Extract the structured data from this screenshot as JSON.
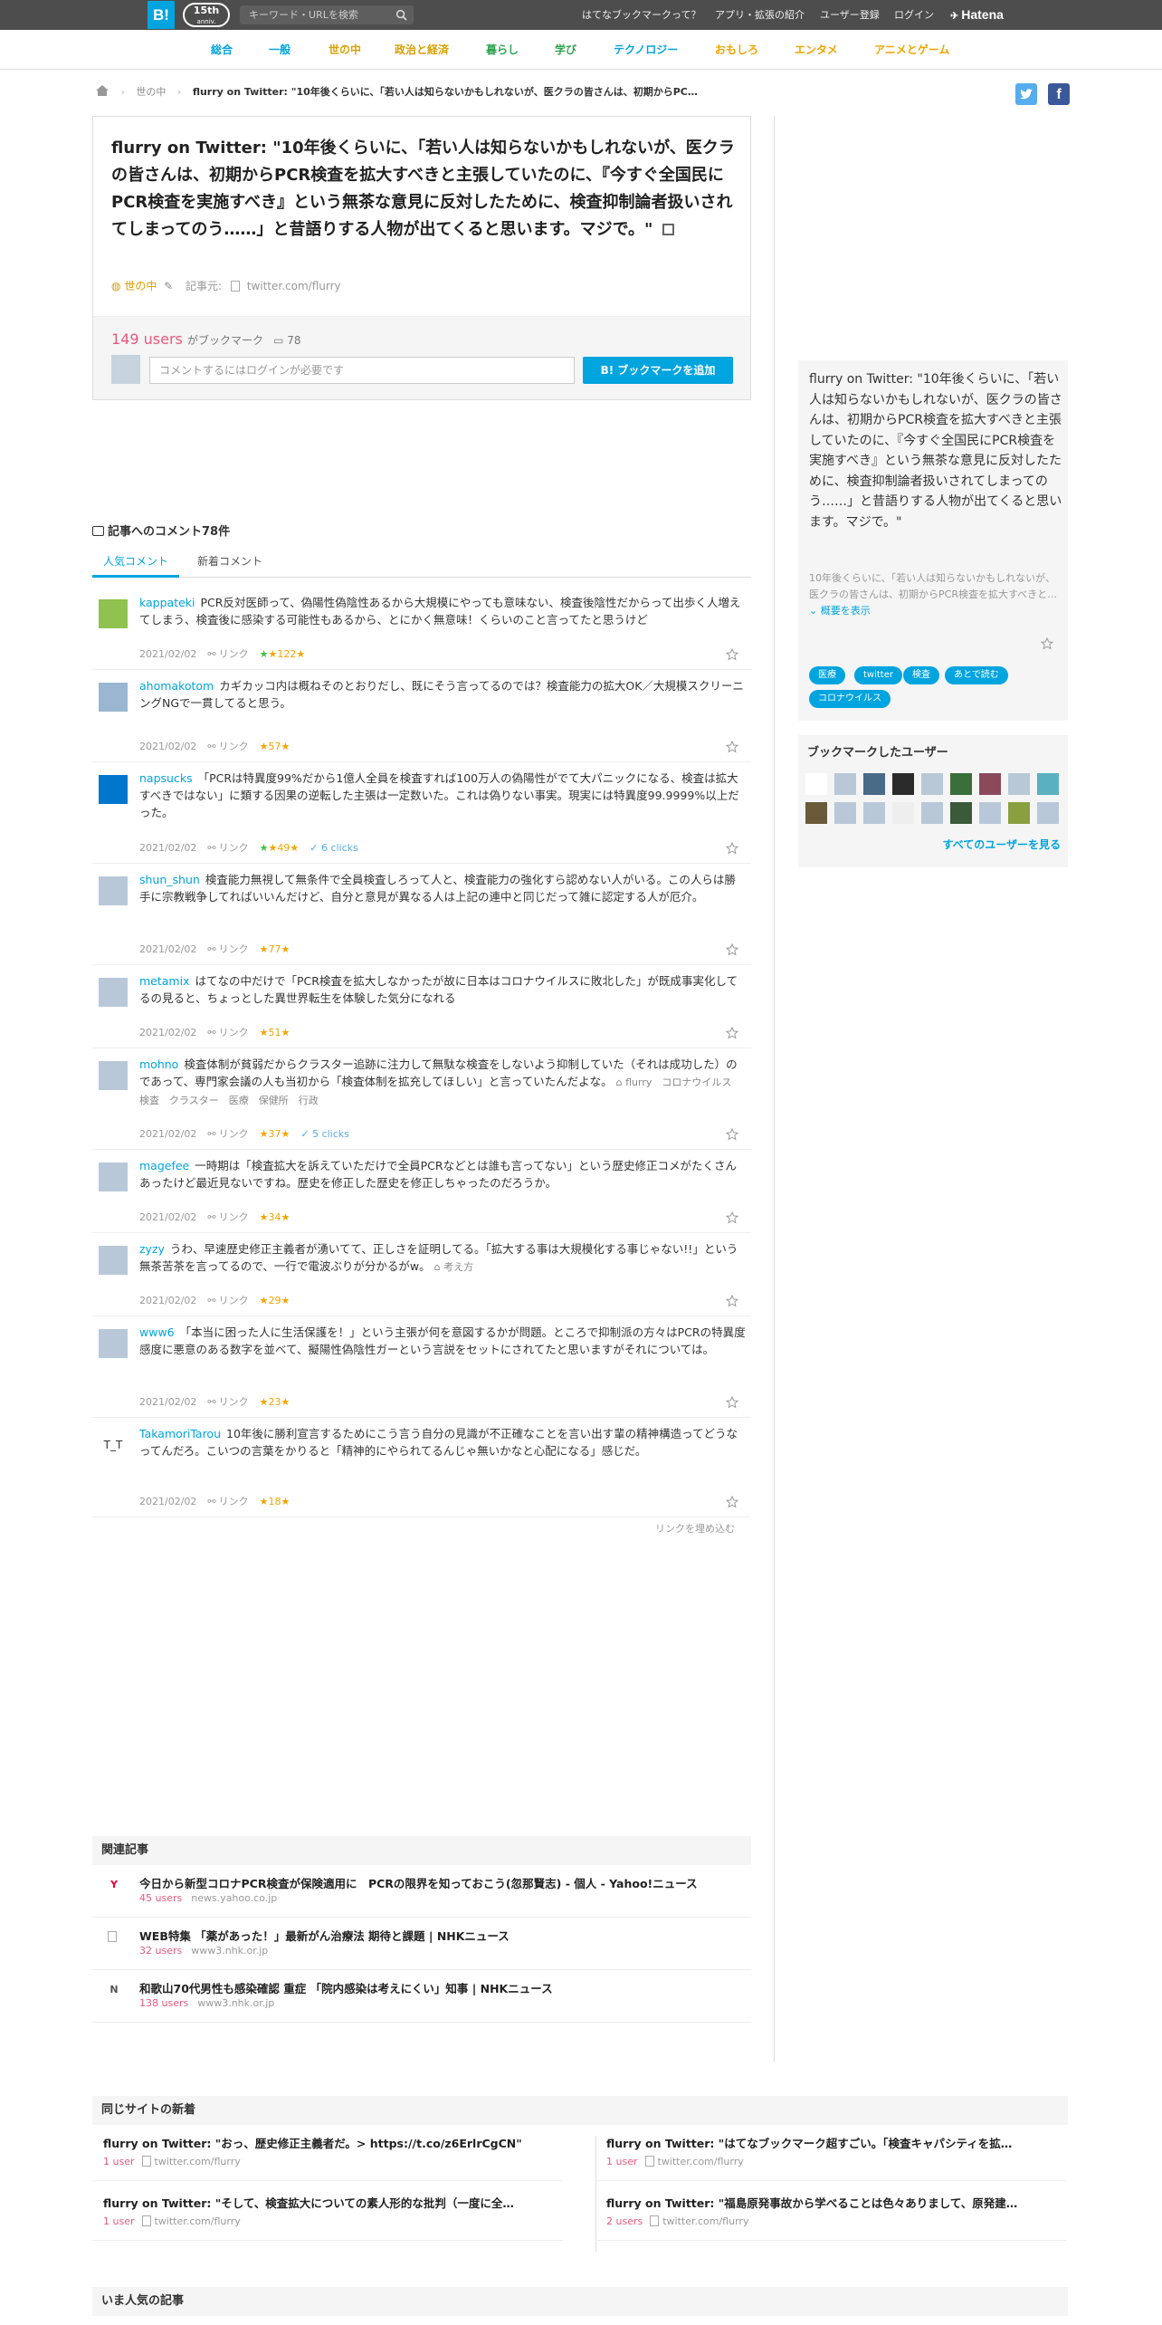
{
  "header": {
    "logo_text": "B!",
    "anniversary_num": "15th",
    "anniversary_sub": "anniv.",
    "search_placeholder": "キーワード・URLを検索",
    "links": [
      "はてなブックマークって？",
      "アプリ・拡張の紹介",
      "ユーザー登録",
      "ログイン"
    ],
    "hatena_label": "Hatena"
  },
  "categories": [
    {
      "label": "総合",
      "color": "#00a4de"
    },
    {
      "label": "一般",
      "color": "#00a4de"
    },
    {
      "label": "世の中",
      "color": "#d9a000"
    },
    {
      "label": "政治と経済",
      "color": "#d9a000"
    },
    {
      "label": "暮らし",
      "color": "#2ea44f"
    },
    {
      "label": "学び",
      "color": "#2ea44f"
    },
    {
      "label": "テクノロジー",
      "color": "#00a4de"
    },
    {
      "label": "おもしろ",
      "color": "#f0a500"
    },
    {
      "label": "エンタメ",
      "color": "#f0a500"
    },
    {
      "label": "アニメとゲーム",
      "color": "#f0a500"
    }
  ],
  "breadcrumb": {
    "category": "世の中",
    "current": "flurry on Twitter: \"10年後くらいに、「若い人は知らないかもしれないが、医クラの皆さんは、初期からPC…"
  },
  "entry": {
    "title": "flurry on Twitter: \"10年後くらいに、「若い人は知らないかもしれないが、医クラの皆さんは、初期からPCR検査を拡大すべきと主張していたのに、『今すぐ全国民にPCR検査を実施すべき』という無茶な意見に反対したために、検査抑制論者扱いされてしまってのう……」と昔語りする人物が出てくると思います。マジで。\"",
    "category": "世の中",
    "source_label": "記事元:",
    "source": "twitter.com/flurry",
    "users": "149 users",
    "users_suffix": "がブックマーク",
    "comment_count": "78",
    "comment_placeholder": "コメントするにはログインが必要です",
    "add_button": "ブックマークを追加"
  },
  "comments_section": {
    "heading": "記事へのコメント78件",
    "tabs": [
      "人気コメント",
      "新着コメント"
    ]
  },
  "comments": [
    {
      "user": "kappateki",
      "text": "PCR反対医師って、偽陽性偽陰性あるから大規模にやっても意味ない、検査後陰性だからって出歩く人増えてしまう、検査後に感染する可能性もあるから、とにかく無意味！くらいのこと言ってたと思うけど",
      "date": "2021/02/02",
      "link": "リンク",
      "green": "★",
      "stars": "★122★",
      "clicks": "",
      "tags": ""
    },
    {
      "user": "ahomakotom",
      "text": "カギカッコ内は概ねそのとおりだし、既にそう言ってるのでは？検査能力の拡大OK／大規模スクリーニングNGで一貫してると思う。",
      "date": "2021/02/02",
      "link": "リンク",
      "green": "",
      "stars": "★57★",
      "clicks": "",
      "tags": ""
    },
    {
      "user": "napsucks",
      "text": "「PCRは特異度99%だから1億人全員を検査すれば100万人の偽陽性がでて大パニックになる、検査は拡大すべきではない」に類する因果の逆転した主張は一定数いた。これは偽りない事実。現実には特異度99.9999%以上だった。",
      "date": "2021/02/02",
      "link": "リンク",
      "green": "★",
      "stars": "★49★",
      "clicks": "6 clicks",
      "tags": ""
    },
    {
      "user": "shun_shun",
      "text": "検査能力無視して無条件で全員検査しろって人と、検査能力の強化すら認めない人がいる。この人らは勝手に宗教戦争してればいいんだけど、自分と意見が異なる人は上記の連中と同じだって雑に認定する人が厄介。",
      "date": "2021/02/02",
      "link": "リンク",
      "green": "",
      "stars": "★77★",
      "clicks": "",
      "tags": ""
    },
    {
      "user": "metamix",
      "text": "はてなの中だけで「PCR検査を拡大しなかったが故に日本はコロナウイルスに敗北した」が既成事実化してるの見ると、ちょっとした異世界転生を体験した気分になれる",
      "date": "2021/02/02",
      "link": "リンク",
      "green": "",
      "stars": "★51★",
      "clicks": "",
      "tags": ""
    },
    {
      "user": "mohno",
      "text": "検査体制が貧弱だからクラスター追跡に注力して無駄な検査をしないよう抑制していた（それは成功した）のであって、専門家会議の人も当初から「検査体制を拡充してほしい」と言っていたんだよな。",
      "date": "2021/02/02",
      "link": "リンク",
      "green": "",
      "stars": "★37★",
      "clicks": "5 clicks",
      "tags": "flurry　コロナウイルス　検査　クラスター　医療　保健所　行政"
    },
    {
      "user": "magefee",
      "text": "一時期は「検査拡大を訴えていただけで全員PCRなどとは誰も言ってない」という歴史修正コメがたくさんあったけど最近見ないですね。歴史を修正した歴史を修正しちゃったのだろうか。",
      "date": "2021/02/02",
      "link": "リンク",
      "green": "",
      "stars": "★34★",
      "clicks": "",
      "tags": ""
    },
    {
      "user": "zyzy",
      "text": "うわ、早速歴史修正主義者が湧いてて、正しさを証明してる。「拡大する事は大規模化する事じゃない!!」という無茶苦茶を言ってるので、一行で電波ぶりが分かるがw。",
      "date": "2021/02/02",
      "link": "リンク",
      "green": "",
      "stars": "★29★",
      "clicks": "",
      "tags": "考え方"
    },
    {
      "user": "www6",
      "text": "「本当に困った人に生活保護を！」という主張が何を意図するかが問題。ところで抑制派の方々はPCRの特異度感度に悪意のある数字を並べて、擬陽性偽陰性ガーという言説をセットにされてたと思いますがそれについては。",
      "date": "2021/02/02",
      "link": "リンク",
      "green": "",
      "stars": "★23★",
      "clicks": "",
      "tags": ""
    },
    {
      "user": "TakamoriTarou",
      "text": "10年後に勝利宣言するためにこう言う自分の見識が不正確なことを言い出す輩の精神構造ってどうなってんだろ。こいつの言葉をかりると「精神的にやられてるんじゃ無いかなと心配になる」感じだ。",
      "date": "2021/02/02",
      "link": "リンク",
      "green": "",
      "stars": "★18★",
      "clicks": "",
      "tags": ""
    }
  ],
  "embed_link": "リンクを埋め込む",
  "summary": {
    "title": "flurry on Twitter: \"10年後くらいに、「若い人は知らないかもしれないが、医クラの皆さんは、初期からPCR検査を拡大すべきと主張していたのに、『今すぐ全国民にPCR検査を実施すべき』という無茶な意見に反対したために、検査抑制論者扱いされてしまってのう……」と昔語りする人物が出てくると思います。マジで。\"",
    "text": "10年後くらいに、「若い人は知らないかもしれないが、医クラの皆さんは、初期からPCR検査を拡大すべきと…",
    "more": "概要を表示",
    "tags": [
      "医療",
      "twitter",
      "検査",
      "あとで読む",
      "コロナウイルス"
    ]
  },
  "bookmark_users": {
    "heading": "ブックマークしたユーザー",
    "see_all": "すべてのユーザーを見る"
  },
  "related": {
    "heading": "関連記事",
    "items": [
      {
        "title": "今日から新型コロナPCR検査が保険適用に　PCRの限界を知っておこう(忽那賢志) - 個人 - Yahoo!ニュース",
        "users": "45 users",
        "domain": "news.yahoo.co.jp",
        "icon": "Y"
      },
      {
        "title": "WEB特集 「薬があった！」最新がん治療法 期待と課題 | NHKニュース",
        "users": "32 users",
        "domain": "www3.nhk.or.jp",
        "icon": ""
      },
      {
        "title": "和歌山70代男性も感染確認 重症 「院内感染は考えにくい」知事 | NHKニュース",
        "users": "138 users",
        "domain": "www3.nhk.or.jp",
        "icon": "N"
      }
    ]
  },
  "same_site": {
    "heading": "同じサイトの新着",
    "items": [
      {
        "title": "flurry on Twitter: \"おっ、歴史修正主義者だ。> https://t.co/z6ErlrCgCN\"",
        "users": "1 user",
        "domain": "twitter.com/flurry"
      },
      {
        "title": "flurry on Twitter: \"はてなブックマーク超すごい。「検査キャパシティを拡…",
        "users": "1 user",
        "domain": "twitter.com/flurry"
      },
      {
        "title": "flurry on Twitter: \"そして、検査拡大についての素人形的な批判（一度に全…",
        "users": "1 user",
        "domain": "twitter.com/flurry"
      },
      {
        "title": "flurry on Twitter: \"福島原発事故から学べることは色々ありまして、原発建…",
        "users": "2 users",
        "domain": "twitter.com/flurry"
      }
    ]
  },
  "popular": {
    "heading": "いま人気の記事"
  }
}
